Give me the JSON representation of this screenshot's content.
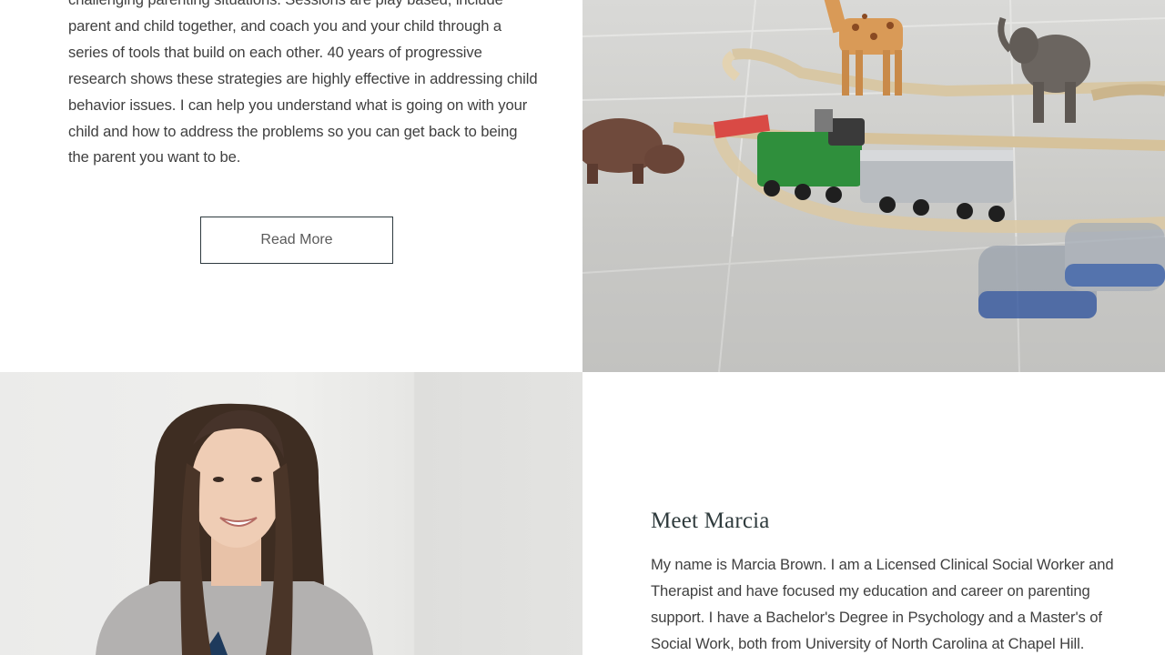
{
  "intro": {
    "lines": [
      "challenging parenting situations.  Sessions are play based, include",
      "parent and child together, and coach you and your child through a",
      "series of tools that build on each other.  40 years of progressive",
      "research shows these strategies are highly effective in addressing child",
      "behavior issues.  I can help you understand what is going on with your",
      "child and how to address the problems so you can get back to being",
      "the parent you want to be."
    ],
    "read_more_label": "Read More"
  },
  "about": {
    "title": "Meet Marcia",
    "lines": [
      "My name is Marcia Brown.  I am a Licensed Clinical Social Worker and",
      "Therapist and have focused my education and career on parenting",
      "support.  I have a Bachelor's Degree in Psychology and a Master's of",
      "Social Work, both from University of North Carolina at Chapel Hill."
    ]
  },
  "colors": {
    "button_border": "#2e3a3f",
    "heading": "#2f3b3d",
    "body_text": "#3f3f3f",
    "train_green": "#2f8f3c",
    "train_silver": "#b8bcc0"
  },
  "images": {
    "toys_photo": "toy-train-and-animals-photo",
    "portrait_photo": "marcia-portrait-photo"
  }
}
